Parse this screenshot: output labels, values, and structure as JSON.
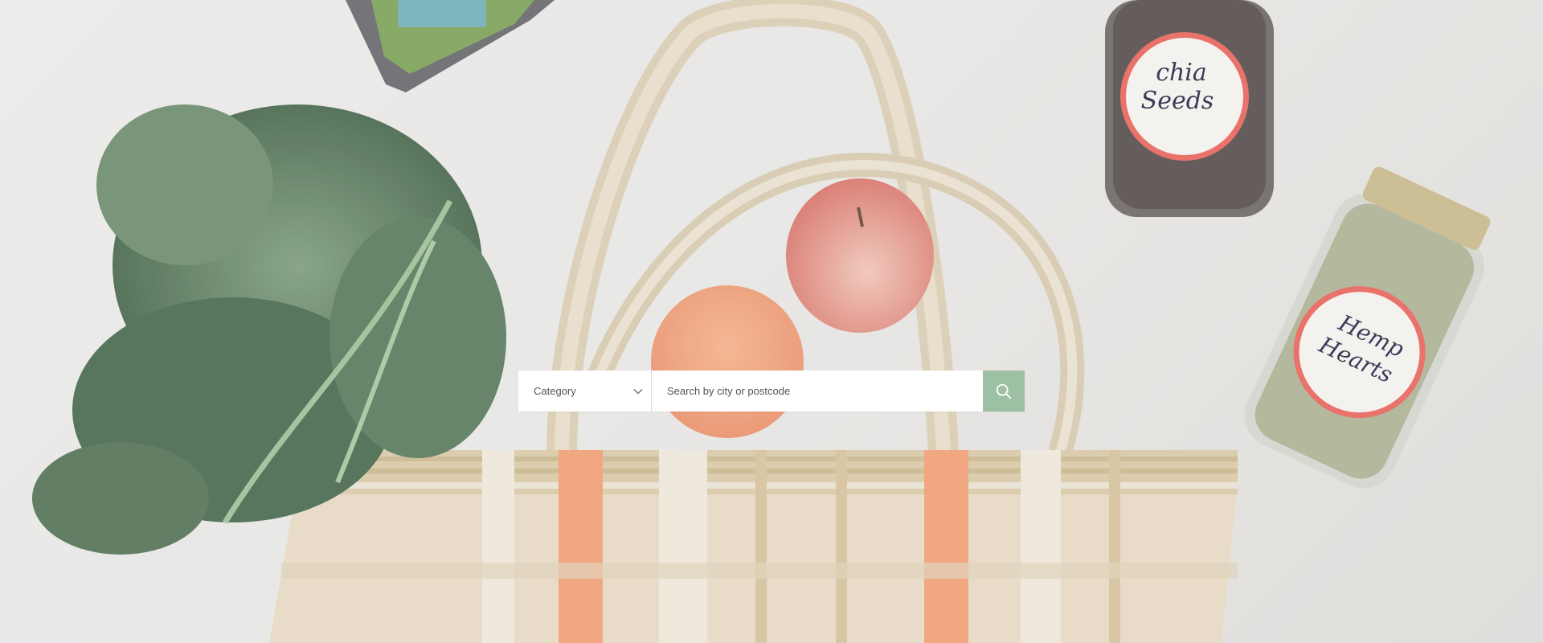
{
  "search": {
    "category_label": "Category",
    "placeholder": "Search by city or postcode",
    "button_color": "#9dc0a4"
  },
  "hero": {
    "jar_1_label": "chia Seeds",
    "jar_2_label": "Hemp Hearts"
  },
  "icons": {
    "dropdown": "chevron-down-icon",
    "search": "search-icon"
  }
}
